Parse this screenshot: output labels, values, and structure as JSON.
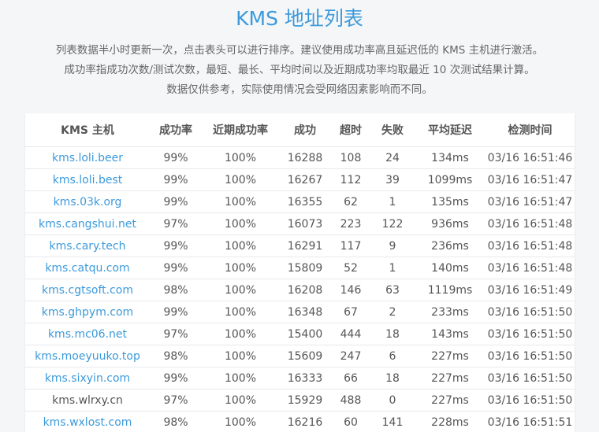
{
  "title": "KMS 地址列表",
  "description": [
    "列表数据半小时更新一次，点击表头可以进行排序。建议使用成功率高且延迟低的 KMS 主机进行激活。",
    "成功率指成功次数/测试次数，最短、最长、平均时间以及近期成功率均取最近 10 次测试结果计算。",
    "数据仅供参考，实际使用情况会受网络因素影响而不同。"
  ],
  "table": {
    "headers": [
      "KMS 主机",
      "成功率",
      "近期成功率",
      "成功",
      "超时",
      "失败",
      "平均延迟",
      "检测时间"
    ],
    "rows": [
      {
        "host": "kms.loli.beer",
        "linked": true,
        "rate": "99%",
        "recent": "100%",
        "success": "16288",
        "timeout": "108",
        "fail": "24",
        "latency": "134ms",
        "time": "03/16 16:51:46"
      },
      {
        "host": "kms.loli.best",
        "linked": true,
        "rate": "99%",
        "recent": "100%",
        "success": "16267",
        "timeout": "112",
        "fail": "39",
        "latency": "1099ms",
        "time": "03/16 16:51:47"
      },
      {
        "host": "kms.03k.org",
        "linked": true,
        "rate": "99%",
        "recent": "100%",
        "success": "16355",
        "timeout": "62",
        "fail": "1",
        "latency": "135ms",
        "time": "03/16 16:51:47"
      },
      {
        "host": "kms.cangshui.net",
        "linked": true,
        "rate": "97%",
        "recent": "100%",
        "success": "16073",
        "timeout": "223",
        "fail": "122",
        "latency": "936ms",
        "time": "03/16 16:51:48"
      },
      {
        "host": "kms.cary.tech",
        "linked": true,
        "rate": "99%",
        "recent": "100%",
        "success": "16291",
        "timeout": "117",
        "fail": "9",
        "latency": "236ms",
        "time": "03/16 16:51:48"
      },
      {
        "host": "kms.catqu.com",
        "linked": true,
        "rate": "99%",
        "recent": "100%",
        "success": "15809",
        "timeout": "52",
        "fail": "1",
        "latency": "140ms",
        "time": "03/16 16:51:48"
      },
      {
        "host": "kms.cgtsoft.com",
        "linked": true,
        "rate": "98%",
        "recent": "100%",
        "success": "16208",
        "timeout": "146",
        "fail": "63",
        "latency": "1119ms",
        "time": "03/16 16:51:49"
      },
      {
        "host": "kms.ghpym.com",
        "linked": true,
        "rate": "99%",
        "recent": "100%",
        "success": "16348",
        "timeout": "67",
        "fail": "2",
        "latency": "233ms",
        "time": "03/16 16:51:50"
      },
      {
        "host": "kms.mc06.net",
        "linked": true,
        "rate": "97%",
        "recent": "100%",
        "success": "15400",
        "timeout": "444",
        "fail": "18",
        "latency": "143ms",
        "time": "03/16 16:51:50"
      },
      {
        "host": "kms.moeyuuko.top",
        "linked": true,
        "rate": "98%",
        "recent": "100%",
        "success": "15609",
        "timeout": "247",
        "fail": "6",
        "latency": "227ms",
        "time": "03/16 16:51:50"
      },
      {
        "host": "kms.sixyin.com",
        "linked": true,
        "rate": "99%",
        "recent": "100%",
        "success": "16333",
        "timeout": "66",
        "fail": "18",
        "latency": "227ms",
        "time": "03/16 16:51:50"
      },
      {
        "host": "kms.wlrxy.cn",
        "linked": false,
        "rate": "97%",
        "recent": "100%",
        "success": "15929",
        "timeout": "488",
        "fail": "0",
        "latency": "227ms",
        "time": "03/16 16:51:50"
      },
      {
        "host": "kms.wxlost.com",
        "linked": true,
        "rate": "98%",
        "recent": "100%",
        "success": "16216",
        "timeout": "60",
        "fail": "141",
        "latency": "228ms",
        "time": "03/16 16:51:51"
      }
    ]
  }
}
